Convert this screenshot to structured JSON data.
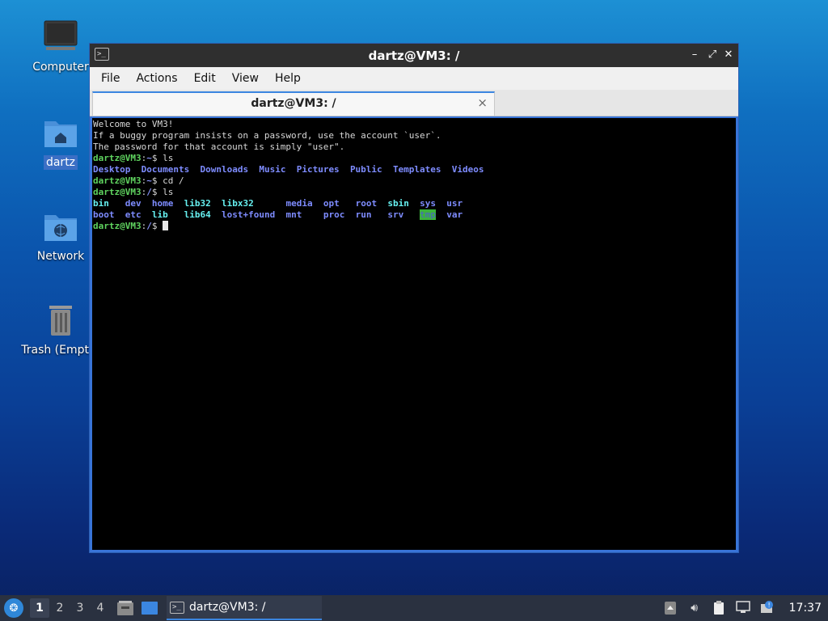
{
  "desktop": {
    "icons": [
      {
        "label": "Computer"
      },
      {
        "label": "dartz"
      },
      {
        "label": "Network"
      },
      {
        "label": "Trash (Empty)"
      }
    ]
  },
  "window": {
    "title": "dartz@VM3: /",
    "menu": [
      "File",
      "Actions",
      "Edit",
      "View",
      "Help"
    ],
    "tab": {
      "label": "dartz@VM3: /",
      "close": "×"
    }
  },
  "terminal": {
    "welcome": [
      "Welcome to VM3!",
      "If a buggy program insists on a password, use the account `user`.",
      "The password for that account is simply \"user\"."
    ],
    "prompt_home": "dartz@VM3",
    "cmd1": "ls",
    "home_ls": [
      "Desktop",
      "Documents",
      "Downloads",
      "Music",
      "Pictures",
      "Public",
      "Templates",
      "Videos"
    ],
    "cmd2": "cd /",
    "cmd3": "ls",
    "root_ls_row1": [
      "bin",
      "dev",
      "home",
      "lib32",
      "libx32",
      "media",
      "opt",
      "root",
      "sbin",
      "sys",
      "usr"
    ],
    "root_ls_row2": [
      "boot",
      "etc",
      "lib",
      "lib64",
      "lost+found",
      "mnt",
      "proc",
      "run",
      "srv",
      "tmp",
      "var"
    ]
  },
  "taskbar": {
    "workspaces": [
      "1",
      "2",
      "3",
      "4"
    ],
    "task_label": "dartz@VM3: /",
    "clock": "17:37"
  },
  "colors": {
    "accent": "#3b86e0",
    "prompt_green": "#5fd35f",
    "dir_blue": "#7e8cff",
    "link_cyan": "#66f0f0"
  }
}
